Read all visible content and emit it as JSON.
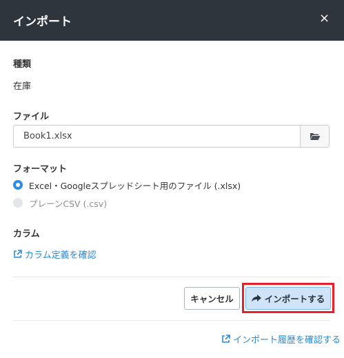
{
  "dialog": {
    "title": "インポート",
    "close_symbol": "×"
  },
  "kind": {
    "label": "種類",
    "value": "在庫"
  },
  "file": {
    "label": "ファイル",
    "value": "Book1.xlsx",
    "browse_icon": "folder-open-icon"
  },
  "format": {
    "label": "フォーマット",
    "options": [
      {
        "label": "Excel・Googleスプレッドシート用のファイル (.xlsx)",
        "checked": true,
        "disabled": false
      },
      {
        "label": "プレーンCSV (.csv)",
        "checked": false,
        "disabled": true
      }
    ]
  },
  "columns": {
    "label": "カラム",
    "link_label": "カラム定義を確認",
    "link_icon": "external-link-icon"
  },
  "footer": {
    "cancel_label": "キャンセル",
    "import_label": "インポートする",
    "import_icon": "share-arrow-icon",
    "history_link_label": "インポート履歴を確認する"
  },
  "colors": {
    "header_bg": "#2f353c",
    "accent": "#2d8ce6",
    "link": "#2a8ad6",
    "highlight": "#e8202a"
  }
}
